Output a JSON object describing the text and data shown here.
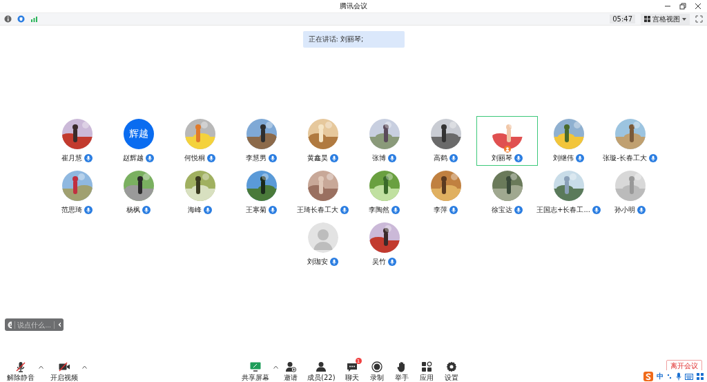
{
  "window": {
    "title": "腾讯会议"
  },
  "topbar": {
    "time": "05:47",
    "view_mode": "宫格视图"
  },
  "speaking_banner": "正在讲话: 刘丽琴;",
  "participants": [
    {
      "name": "崔月慧",
      "speaking": false
    },
    {
      "name": "赵辉越",
      "kind": "text",
      "avatar_text": "辉越",
      "speaking": false
    },
    {
      "name": "何悦桐",
      "speaking": false
    },
    {
      "name": "李慧男",
      "speaking": false
    },
    {
      "name": "黄鑫昊",
      "speaking": false
    },
    {
      "name": "张博",
      "speaking": false
    },
    {
      "name": "高鹤",
      "speaking": false
    },
    {
      "name": "刘丽琴",
      "speaking": true
    },
    {
      "name": "刘继伟",
      "speaking": false
    },
    {
      "name": "张璇-长春工大",
      "speaking": false
    },
    {
      "name": "范思琦",
      "speaking": false
    },
    {
      "name": "杨枫",
      "speaking": false
    },
    {
      "name": "海峰",
      "speaking": false
    },
    {
      "name": "王寒菊",
      "speaking": false
    },
    {
      "name": "王琦长春工大",
      "speaking": false
    },
    {
      "name": "李陶然",
      "speaking": false
    },
    {
      "name": "李萍",
      "speaking": false
    },
    {
      "name": "徐宝达",
      "speaking": false
    },
    {
      "name": "王国志+长春工...",
      "speaking": false
    },
    {
      "name": "孙小明",
      "speaking": false
    },
    {
      "name": "刘珈安",
      "kind": "default",
      "speaking": false
    },
    {
      "name": "吴竹",
      "speaking": false
    }
  ],
  "chat_box": {
    "placeholder": "说点什么..."
  },
  "toolbar_left": [
    {
      "kind": "mic",
      "label": "解除静音",
      "muted": true
    },
    {
      "kind": "video",
      "label": "开启视频",
      "muted": true
    }
  ],
  "toolbar_center": [
    {
      "kind": "share",
      "label": "共享屏幕",
      "caret": true
    },
    {
      "kind": "invite",
      "label": "邀请",
      "caret": false
    },
    {
      "kind": "members",
      "label": "成员(22)",
      "caret": false
    },
    {
      "kind": "chat",
      "label": "聊天",
      "caret": false,
      "badge": "1"
    },
    {
      "kind": "record",
      "label": "录制",
      "caret": false
    },
    {
      "kind": "hand",
      "label": "举手",
      "caret": false
    },
    {
      "kind": "apps",
      "label": "应用",
      "caret": false
    },
    {
      "kind": "settings",
      "label": "设置",
      "caret": false
    }
  ],
  "leave_button": "离开会议",
  "ime_bar": {
    "mode": "中"
  }
}
